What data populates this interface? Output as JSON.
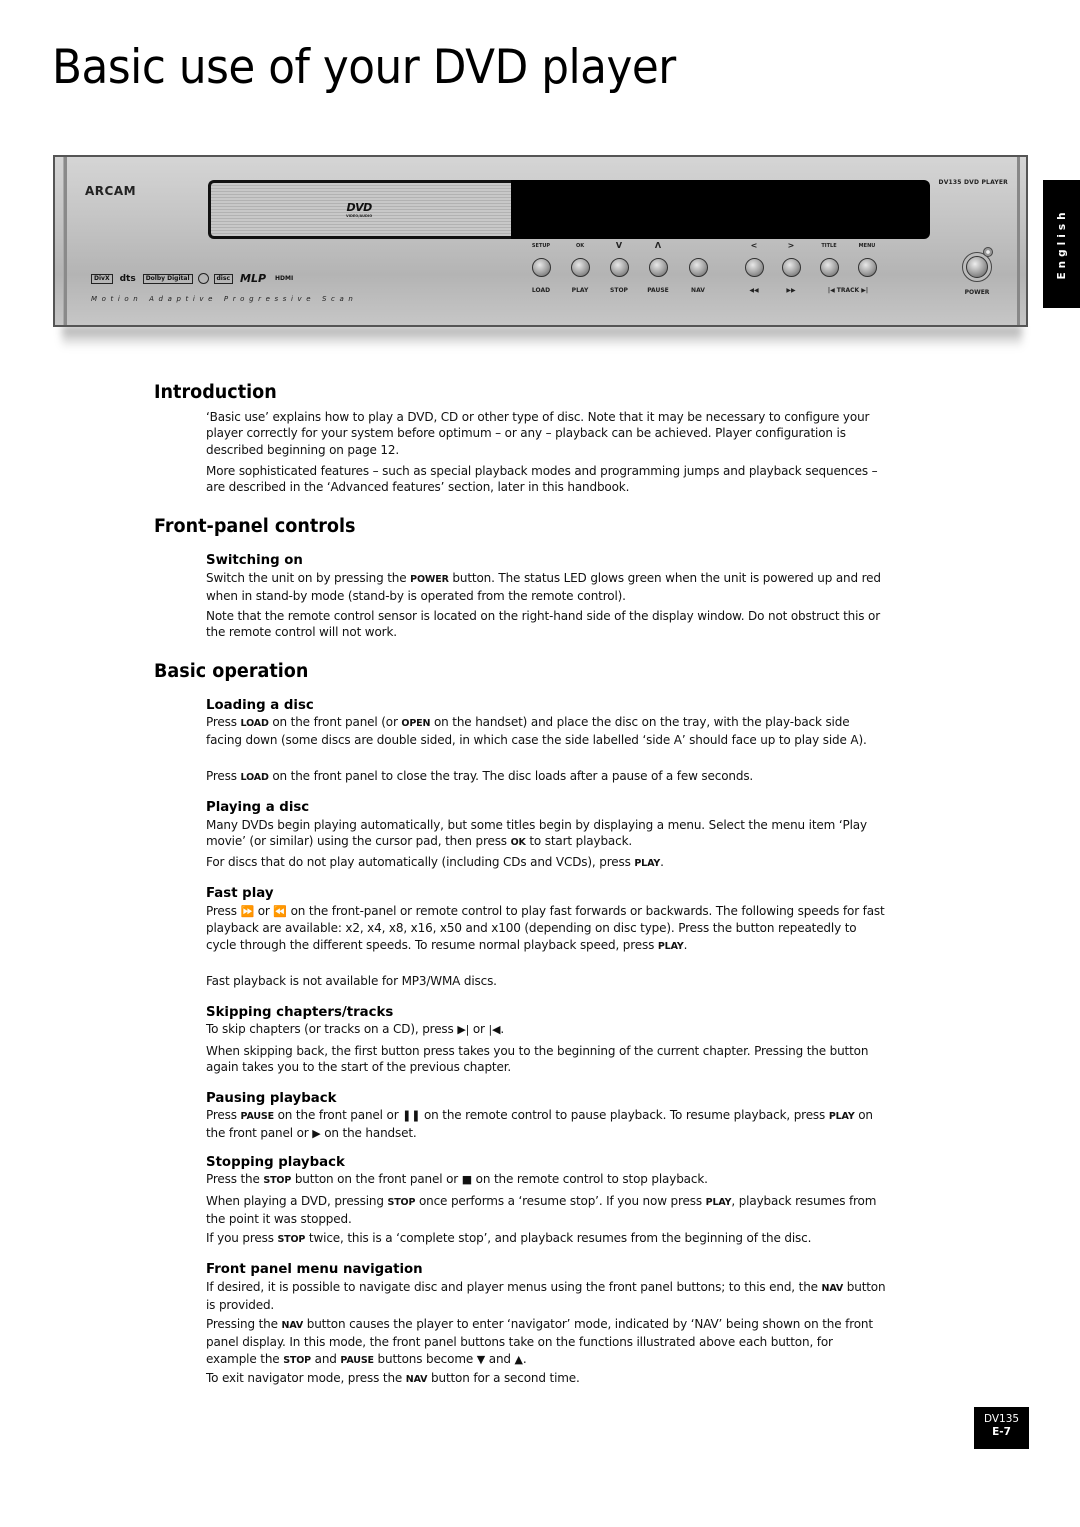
{
  "page": {
    "title": "Basic use of your DVD player",
    "language_tab": "English",
    "footer": {
      "model": "DV135",
      "page_number": "E-7"
    }
  },
  "device": {
    "brand": "ARCAM",
    "model_label": "DV135 DVD PLAYER",
    "tray_logo": {
      "main": "DVD",
      "sub": "VIDEO/AUDIO"
    },
    "format_logos": [
      "DivX",
      "dts",
      "Dolby Digital",
      "SACD",
      "Compact Disc",
      "MLP",
      "HDMI"
    ],
    "tagline": "Motion Adaptive Progressive Scan",
    "buttons": [
      {
        "top": "SETUP",
        "bottom": "LOAD"
      },
      {
        "top": "OK",
        "bottom": "PLAY"
      },
      {
        "top": "V",
        "bottom": "STOP"
      },
      {
        "top": "Λ",
        "bottom": "PAUSE"
      },
      {
        "top": "",
        "bottom": "NAV"
      },
      {
        "top": "<",
        "bottom": "◀◀"
      },
      {
        "top": ">",
        "bottom": "▶▶"
      },
      {
        "top": "TITLE",
        "bottom": ""
      },
      {
        "top": "MENU",
        "bottom": ""
      }
    ],
    "track_label": "|◀ TRACK ▶|",
    "power_label": "POWER"
  },
  "sections": {
    "introduction": {
      "heading": "Introduction",
      "paragraphs": [
        "‘Basic use’ explains how to play a DVD, CD or other type of disc. Note that it may be necessary to configure your player correctly for your system before optimum – or any – playback can be achieved. Player configuration is described beginning on page 12.",
        "More sophisticated features – such as special playback modes and programming jumps and playback sequences – are described in the ‘Advanced features’ section, later in this handbook."
      ]
    },
    "front_panel": {
      "heading": "Front-panel controls",
      "switching_on": {
        "heading": "Switching on",
        "p1_a": "Switch the unit on by pressing the ",
        "p1_key": "POWER",
        "p1_b": " button. The status LED glows green when the unit is powered up and red when in stand-by mode (stand-by is operated from the remote control).",
        "p2": "Note that the remote control sensor is located on the right-hand side of the display window. Do not obstruct this or the remote control will not work."
      }
    },
    "basic_operation": {
      "heading": "Basic operation",
      "loading": {
        "heading": "Loading a disc",
        "p1_a": "Press ",
        "p1_key1": "LOAD",
        "p1_b": " on the front panel (or ",
        "p1_key2": "OPEN",
        "p1_c": " on the handset) and place the disc on the tray, with the play-back side facing down (some discs are double sided, in which case the side labelled ‘side A’ should face up to play side A).",
        "p2_a": "Press ",
        "p2_key": "LOAD",
        "p2_b": " on the front panel to close the tray. The disc loads after a pause of a few seconds."
      },
      "playing": {
        "heading": "Playing a disc",
        "p1_a": "Many DVDs begin playing automatically, but some titles begin by displaying a menu. Select the menu item ‘Play movie’ (or similar) using the cursor pad, then press ",
        "p1_key": "OK",
        "p1_b": " to start playback.",
        "p2_a": "For discs that do not play automatically (including CDs and VCDs), press ",
        "p2_key": "PLAY",
        "p2_b": "."
      },
      "fast_play": {
        "heading": "Fast play",
        "p1_a": "Press ",
        "ff_icon": "⏩",
        "p1_or": " or ",
        "rw_icon": "⏪",
        "p1_b": " on the front-panel or remote control to play fast forwards or backwards. The following speeds for fast playback are available: x2, x4, x8, x16, x50 and x100 (depending on disc type). Press the button repeatedly to cycle through the different speeds. To resume normal playback speed, press ",
        "p1_key": "PLAY",
        "p1_c": ".",
        "p2": "Fast playback is not available for MP3/WMA discs."
      },
      "skipping": {
        "heading": "Skipping chapters/tracks",
        "p1_a": "To skip chapters (or tracks on a CD), press ",
        "next_icon": "▶|",
        "p1_or": " or ",
        "prev_icon": "|◀",
        "p1_b": ".",
        "p2": "When skipping back, the first button press takes you to the beginning of the current chapter. Pressing the button again takes you to the start of the previous chapter."
      },
      "pausing": {
        "heading": "Pausing playback",
        "p1_a": "Press ",
        "p1_key1": "PAUSE",
        "p1_b": " on the front panel or ",
        "pause_icon": "❚❚",
        "p1_c": " on the remote control to pause playback. To resume playback, press ",
        "p1_key2": "PLAY",
        "p1_d": " on the front panel or ",
        "play_icon": "▶",
        "p1_e": " on the handset."
      },
      "stopping": {
        "heading": "Stopping playback",
        "p1_a": "Press the ",
        "p1_key": "STOP",
        "p1_b": " button on the front panel or ",
        "stop_icon": "■",
        "p1_c": " on the remote control to stop playback.",
        "p2_a": "When playing a DVD, pressing ",
        "p2_key1": "STOP",
        "p2_b": " once performs a ‘resume stop’. If you now press ",
        "p2_key2": "PLAY",
        "p2_c": ", playback resumes from the point it was stopped.",
        "p3_a": "If you press ",
        "p3_key": "STOP",
        "p3_b": " twice, this is a ‘complete stop’, and playback resumes from the beginning of the disc."
      },
      "navigation": {
        "heading": "Front panel menu navigation",
        "p1_a": "If desired, it is possible to navigate disc and player menus using the front panel buttons; to this end, the ",
        "p1_key": "NAV",
        "p1_b": " button is provided.",
        "p2_a": "Pressing the ",
        "p2_key1": "NAV",
        "p2_b": " button causes the player to enter ‘navigator’ mode, indicated by ‘NAV’ being shown on the front panel display. In this mode, the front panel buttons take on the functions illustrated above each button, for example the ",
        "p2_key2": "STOP",
        "p2_c": " and ",
        "p2_key3": "PAUSE",
        "p2_d": " buttons become ",
        "down_icon": "▼",
        "p2_e": " and ",
        "up_icon": "▲",
        "p2_f": ".",
        "p3_a": "To exit navigator mode, press the ",
        "p3_key": "NAV",
        "p3_b": " button for a second time."
      }
    }
  }
}
